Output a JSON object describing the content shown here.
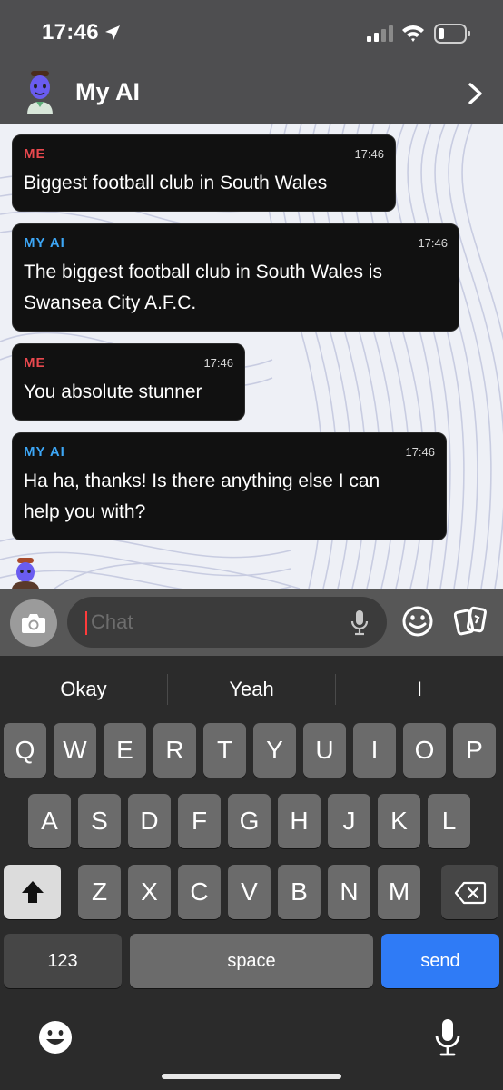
{
  "status": {
    "time": "17:46"
  },
  "header": {
    "title": "My AI"
  },
  "messages": [
    {
      "sender": "ME",
      "time": "17:46",
      "lines": [
        "Biggest football club in South Wales"
      ]
    },
    {
      "sender": "MY AI",
      "time": "17:46",
      "lines": [
        "The biggest football club in South Wales is",
        "Swansea City A.F.C."
      ]
    },
    {
      "sender": "ME",
      "time": "17:46",
      "lines": [
        "You absolute stunner"
      ]
    },
    {
      "sender": "MY AI",
      "time": "17:46",
      "lines": [
        "Ha ha, thanks! Is there anything else I can",
        "help you with?"
      ]
    }
  ],
  "input": {
    "placeholder": "Chat"
  },
  "suggestions": [
    "Okay",
    "Yeah",
    "I"
  ],
  "keyboard": {
    "row1": [
      "Q",
      "W",
      "E",
      "R",
      "T",
      "Y",
      "U",
      "I",
      "O",
      "P"
    ],
    "row2": [
      "A",
      "S",
      "D",
      "F",
      "G",
      "H",
      "J",
      "K",
      "L"
    ],
    "row3": [
      "Z",
      "X",
      "C",
      "V",
      "B",
      "N",
      "M"
    ],
    "numbers_label": "123",
    "space_label": "space",
    "send_label": "send"
  },
  "colors": {
    "me": "#e8484e",
    "ai": "#3da6f5",
    "send": "#2f7bf6"
  }
}
